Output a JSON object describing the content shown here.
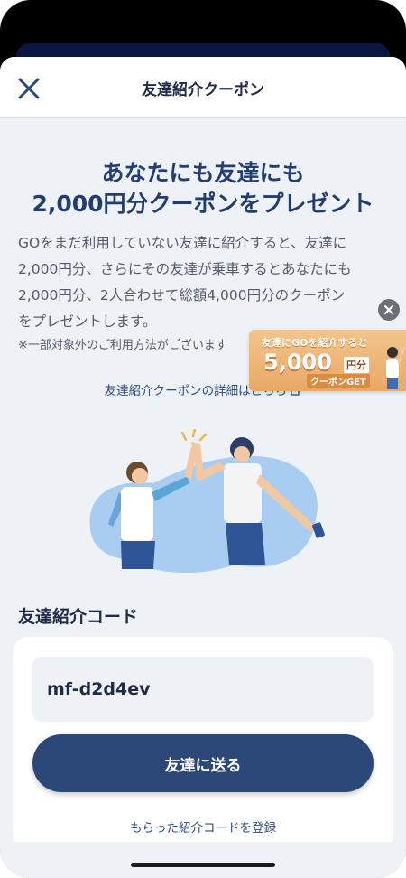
{
  "header": {
    "title": "友達紹介クーポン",
    "close_icon": "close-icon"
  },
  "hero": {
    "headline_line1": "あなたにも友達にも",
    "headline_line2": "2,000円分クーポンをプレゼント"
  },
  "description": {
    "line1": "GOをまだ利用していない友達に紹介すると、友達に",
    "line2": "2,000円分、さらにその友達が乗車するとあなたにも",
    "line3": "2,000円分、2人合わせて総額4,000円分のクーポン",
    "line4": "をプレゼントします。"
  },
  "note": "※一部対象外のご利用方法がございます",
  "detail_link": "友達紹介クーポンの詳細はこちら",
  "banner": {
    "line1": "友達にGOを紹介すると",
    "amount": "5,000",
    "unit": "円分",
    "line3": "クーポンGET"
  },
  "code_section": {
    "title": "友達紹介コード",
    "code": "mf-d2d4ev",
    "send_button": "友達に送る",
    "register_link": "もらった紹介コードを登録"
  },
  "colors": {
    "accent": "#2b4878",
    "headline": "#233d70",
    "background": "#eef2f7"
  }
}
